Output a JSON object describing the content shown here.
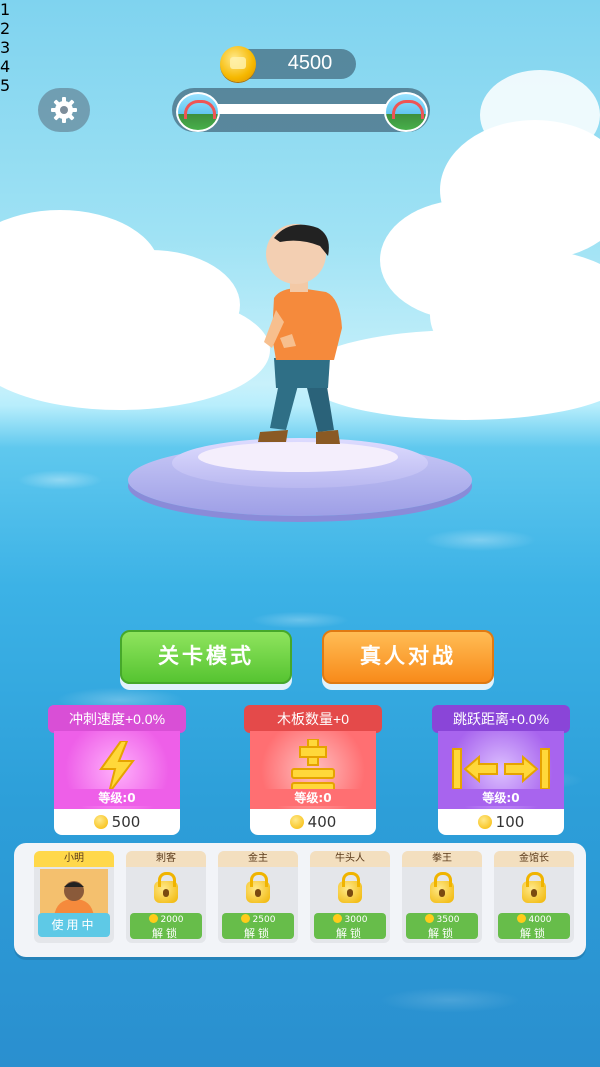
{
  "hud": {
    "coins": "4500",
    "level_nodes": [
      "1",
      "2",
      "3",
      "4",
      "5"
    ]
  },
  "modes": {
    "level_mode": "关卡模式",
    "pvp_mode": "真人对战"
  },
  "upgrades": [
    {
      "title": "冲刺速度+0.0%",
      "level_label": "等级:",
      "level": "0",
      "price": "500",
      "icon": "lightning-icon",
      "tag_color": "#d94fd6",
      "body_color": "#ee5fe8"
    },
    {
      "title": "木板数量+0",
      "level_label": "等级:",
      "level": "0",
      "price": "400",
      "icon": "plank-plus-icon",
      "tag_color": "#e44a4a",
      "body_color": "#ff6f72"
    },
    {
      "title": "跳跃距离+0.0%",
      "level_label": "等级:",
      "level": "0",
      "price": "100",
      "icon": "jump-arrows-icon",
      "tag_color": "#8a45d8",
      "body_color": "#a864ee"
    }
  ],
  "roster": [
    {
      "name": "小明",
      "status": "使用中"
    },
    {
      "name": "刺客",
      "cost": "2000",
      "action": "解锁"
    },
    {
      "name": "金主",
      "cost": "2500",
      "action": "解锁"
    },
    {
      "name": "牛头人",
      "cost": "3000",
      "action": "解锁"
    },
    {
      "name": "拳王",
      "cost": "3500",
      "action": "解锁"
    },
    {
      "name": "金馆长",
      "cost": "4000",
      "action": "解锁"
    }
  ],
  "colors": {
    "coin": "#f6b800",
    "unlock_green": "#67bd4a",
    "in_use_blue": "#5ec9e6"
  }
}
